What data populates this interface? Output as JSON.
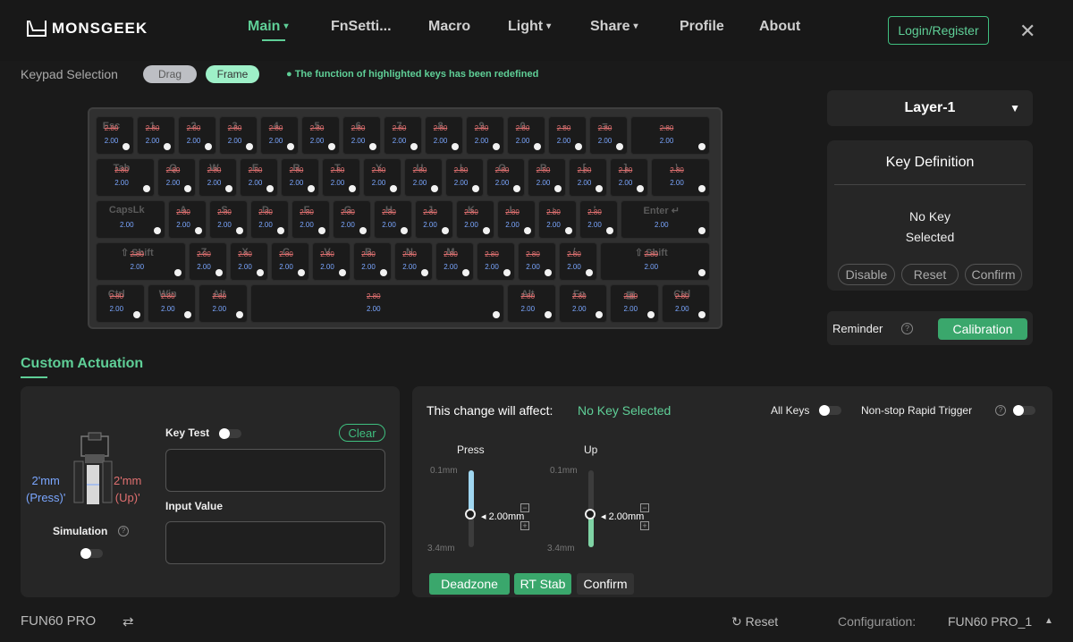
{
  "header": {
    "brand": "MONSGEEK",
    "nav": [
      {
        "label": "Main",
        "caret": "▾"
      },
      {
        "label": "FnSetti...",
        "caret": ""
      },
      {
        "label": "Macro",
        "caret": ""
      },
      {
        "label": "Light",
        "caret": "▾"
      },
      {
        "label": "Share",
        "caret": "▾"
      },
      {
        "label": "Profile",
        "caret": ""
      },
      {
        "label": "About",
        "caret": ""
      }
    ],
    "login": "Login/Register",
    "close": "✕"
  },
  "keypad": {
    "label": "Keypad Selection",
    "drag": "Drag",
    "frame": "Frame",
    "note": "The function of highlighted keys has been redefined"
  },
  "keyboard": {
    "rows": [
      [
        {
          "legend": "Esc",
          "top": "2.80",
          "bottom": "2.00"
        },
        {
          "legend": "1",
          "top": "2.80",
          "bottom": "2.00"
        },
        {
          "legend": "2",
          "top": "2.80",
          "bottom": "2.00"
        },
        {
          "legend": "3",
          "top": "2.80",
          "bottom": "2.00"
        },
        {
          "legend": "4",
          "top": "2.80",
          "bottom": "2.00"
        },
        {
          "legend": "5",
          "top": "2.80",
          "bottom": "2.00"
        },
        {
          "legend": "6",
          "top": "2.80",
          "bottom": "2.00"
        },
        {
          "legend": "7",
          "top": "2.80",
          "bottom": "2.00"
        },
        {
          "legend": "8",
          "top": "2.80",
          "bottom": "2.00"
        },
        {
          "legend": "9",
          "top": "2.80",
          "bottom": "2.00"
        },
        {
          "legend": "0",
          "top": "2.80",
          "bottom": "2.00"
        },
        {
          "legend": "-",
          "top": "2.80",
          "bottom": "2.00"
        },
        {
          "legend": "=",
          "top": "2.80",
          "bottom": "2.00"
        },
        {
          "legend": "←",
          "top": "2.80",
          "bottom": "2.00"
        }
      ],
      [
        {
          "legend": "Tab",
          "top": "2.80",
          "bottom": "2.00"
        },
        {
          "legend": "Q",
          "top": "2.80",
          "bottom": "2.00"
        },
        {
          "legend": "W",
          "top": "2.80",
          "bottom": "2.00"
        },
        {
          "legend": "E",
          "top": "2.80",
          "bottom": "2.00"
        },
        {
          "legend": "R",
          "top": "2.80",
          "bottom": "2.00"
        },
        {
          "legend": "T",
          "top": "2.80",
          "bottom": "2.00"
        },
        {
          "legend": "Y",
          "top": "2.80",
          "bottom": "2.00"
        },
        {
          "legend": "U",
          "top": "2.80",
          "bottom": "2.00"
        },
        {
          "legend": "I",
          "top": "2.80",
          "bottom": "2.00"
        },
        {
          "legend": "O",
          "top": "2.80",
          "bottom": "2.00"
        },
        {
          "legend": "P",
          "top": "2.80",
          "bottom": "2.00"
        },
        {
          "legend": "[",
          "top": "2.80",
          "bottom": "2.00"
        },
        {
          "legend": "]",
          "top": "2.80",
          "bottom": "2.00"
        },
        {
          "legend": "\\",
          "top": "2.80",
          "bottom": "2.00"
        }
      ],
      [
        {
          "legend": "CapsLk",
          "top": "",
          "bottom": "2.00"
        },
        {
          "legend": "A",
          "top": "2.80",
          "bottom": "2.00"
        },
        {
          "legend": "S",
          "top": "2.80",
          "bottom": "2.00"
        },
        {
          "legend": "D",
          "top": "2.80",
          "bottom": "2.00"
        },
        {
          "legend": "F",
          "top": "2.80",
          "bottom": "2.00"
        },
        {
          "legend": "G",
          "top": "2.80",
          "bottom": "2.00"
        },
        {
          "legend": "H",
          "top": "2.80",
          "bottom": "2.00"
        },
        {
          "legend": "J",
          "top": "2.80",
          "bottom": "2.00"
        },
        {
          "legend": "K",
          "top": "2.80",
          "bottom": "2.00"
        },
        {
          "legend": "L",
          "top": "2.80",
          "bottom": "2.00"
        },
        {
          "legend": ";",
          "top": "2.80",
          "bottom": "2.00"
        },
        {
          "legend": "'",
          "top": "2.80",
          "bottom": "2.00"
        },
        {
          "legend": "Enter ↵",
          "top": "",
          "bottom": "2.00"
        }
      ],
      [
        {
          "legend": "⇧ Shift",
          "top": "2.80",
          "bottom": "2.00"
        },
        {
          "legend": "Z",
          "top": "2.80",
          "bottom": "2.00"
        },
        {
          "legend": "X",
          "top": "2.80",
          "bottom": "2.00"
        },
        {
          "legend": "C",
          "top": "2.80",
          "bottom": "2.00"
        },
        {
          "legend": "V",
          "top": "2.80",
          "bottom": "2.00"
        },
        {
          "legend": "B",
          "top": "2.80",
          "bottom": "2.00"
        },
        {
          "legend": "N",
          "top": "2.80",
          "bottom": "2.00"
        },
        {
          "legend": "M",
          "top": "2.80",
          "bottom": "2.00"
        },
        {
          "legend": ",",
          "top": "2.80",
          "bottom": "2.00"
        },
        {
          "legend": ".",
          "top": "2.80",
          "bottom": "2.00"
        },
        {
          "legend": "/",
          "top": "2.80",
          "bottom": "2.00"
        },
        {
          "legend": "⇧ Shift",
          "top": "2.80",
          "bottom": "2.00"
        }
      ],
      [
        {
          "legend": "Ctrl",
          "top": "2.80",
          "bottom": "2.00"
        },
        {
          "legend": "Win",
          "top": "2.80",
          "bottom": "2.00"
        },
        {
          "legend": "Alt",
          "top": "2.80",
          "bottom": "2.00"
        },
        {
          "legend": "",
          "top": "2.80",
          "bottom": "2.00"
        },
        {
          "legend": "Alt",
          "top": "2.80",
          "bottom": "2.00"
        },
        {
          "legend": "Fn",
          "top": "2.80",
          "bottom": "2.00"
        },
        {
          "legend": "▤",
          "top": "2.80",
          "bottom": "2.00"
        },
        {
          "legend": "Ctrl",
          "top": "2.80",
          "bottom": "2.00"
        }
      ]
    ]
  },
  "right": {
    "layer": "Layer-1",
    "layer_arrow": "▼",
    "keydef_title": "Key Definition",
    "keydef_msg1": "No Key",
    "keydef_msg2": "Selected",
    "disable": "Disable",
    "reset": "Reset",
    "confirm": "Confirm",
    "reminder": "Reminder",
    "calibration": "Calibration"
  },
  "custom": {
    "title": "Custom Actuation",
    "key_test": "Key Test",
    "clear": "Clear",
    "input_value": "Input Value",
    "press_mm": "2'mm",
    "press_lbl": "(Press)'",
    "up_mm": "2'mm",
    "up_lbl": "(Up)'",
    "simulation": "Simulation",
    "affect_label": "This change will affect:",
    "affect_value": "No Key Selected",
    "all_keys": "All Keys",
    "rapid_trigger": "Non-stop Rapid Trigger",
    "press": "Press",
    "up": "Up",
    "min": "0.1mm",
    "max": "3.4mm",
    "press_value": "2.00mm",
    "up_value": "2.00mm",
    "press_level": 0.57,
    "up_level": 0.57,
    "deadzone": "Deadzone",
    "rt_stab": "RT Stab",
    "confirm": "Confirm"
  },
  "footer": {
    "model": "FUN60 PRO",
    "reset": "Reset",
    "config_label": "Configuration:",
    "config_value": "FUN60 PRO_1",
    "caret": "▲"
  },
  "colors": {
    "accent": "#5fcf97",
    "press": "#7aa6ff",
    "up": "#e07070"
  }
}
